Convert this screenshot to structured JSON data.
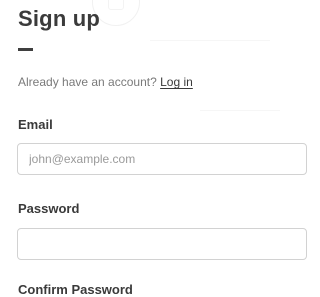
{
  "form": {
    "title": "Sign up",
    "login_prompt": "Already have an account?",
    "login_link": "Log in",
    "fields": [
      {
        "label": "Email",
        "placeholder": "john@example.com",
        "value": ""
      },
      {
        "label": "Password",
        "placeholder": "",
        "value": ""
      },
      {
        "label": "Confirm Password"
      }
    ]
  },
  "colors": {
    "text": "#3a3a3a",
    "muted": "#7a7a7a",
    "border": "#d2d2d2",
    "background": "#ffffff"
  }
}
